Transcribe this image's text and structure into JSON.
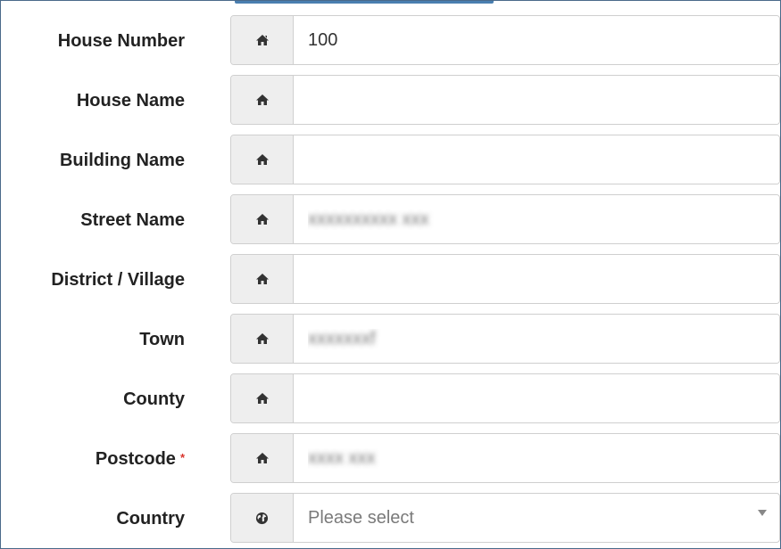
{
  "form": {
    "fields": [
      {
        "label": "House Number",
        "value": "100",
        "placeholder": "",
        "icon": "home-icon"
      },
      {
        "label": "House Name",
        "value": "",
        "placeholder": "",
        "icon": "home-icon"
      },
      {
        "label": "Building Name",
        "value": "",
        "placeholder": "",
        "icon": "home-icon"
      },
      {
        "label": "Street Name",
        "value": "xxxxxxxxxx xxx",
        "placeholder": "",
        "icon": "home-icon"
      },
      {
        "label": "District / Village",
        "value": "",
        "placeholder": "",
        "icon": "home-icon"
      },
      {
        "label": "Town",
        "value": "xxxxxxxf",
        "placeholder": "",
        "icon": "home-icon"
      },
      {
        "label": "County",
        "value": "",
        "placeholder": "",
        "icon": "home-icon"
      },
      {
        "label": "Postcode",
        "required_marker": "*",
        "value": "xxxx xxx",
        "placeholder": "",
        "icon": "home-icon"
      }
    ],
    "country": {
      "label": "Country",
      "selected": "Please select",
      "icon": "globe-icon"
    }
  },
  "colors": {
    "addon_bg": "#eeeeee",
    "border": "#cfcfcf",
    "required": "#d9342b",
    "accent": "#4a7fb0"
  }
}
